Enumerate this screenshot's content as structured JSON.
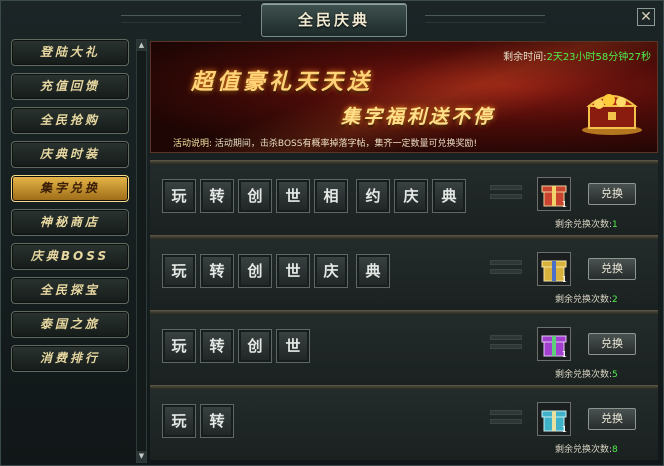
{
  "window": {
    "title": "全民庆典",
    "close_label": "✕"
  },
  "sidebar": {
    "items": [
      {
        "label": "登陆大礼",
        "active": false
      },
      {
        "label": "充值回馈",
        "active": false
      },
      {
        "label": "全民抢购",
        "active": false
      },
      {
        "label": "庆典时装",
        "active": false
      },
      {
        "label": "集字兑换",
        "active": true
      },
      {
        "label": "神秘商店",
        "active": false
      },
      {
        "label": "庆典BOSS",
        "active": false
      },
      {
        "label": "全民探宝",
        "active": false
      },
      {
        "label": "泰国之旅",
        "active": false
      },
      {
        "label": "消费排行",
        "active": false
      }
    ]
  },
  "banner": {
    "timer_label": "剩余时间:",
    "timer_value": "2天23小时58分钟27秒",
    "slogan1": "超值豪礼天天送",
    "slogan2": "集字福利送不停",
    "desc_label": "活动说明:",
    "desc_text": "活动期间，击杀BOSS有概率掉落字帖，集齐一定数量可兑换奖励!"
  },
  "rows": [
    {
      "tiles": [
        "玩",
        "转",
        "创",
        "世",
        "相",
        "约",
        "庆",
        "典"
      ],
      "gift_color": "#c9432f",
      "gift_count": "1",
      "button": "兑换",
      "remain_label": "剩余兑换次数:",
      "remain": "1"
    },
    {
      "tiles": [
        "玩",
        "转",
        "创",
        "世",
        "庆",
        "典"
      ],
      "gift_color": "#d8b23c",
      "gift_count": "1",
      "button": "兑换",
      "remain_label": "剩余兑换次数:",
      "remain": "2"
    },
    {
      "tiles": [
        "玩",
        "转",
        "创",
        "世"
      ],
      "gift_color": "#a33fcf",
      "gift_count": "1",
      "button": "兑换",
      "remain_label": "剩余兑换次数:",
      "remain": "5"
    },
    {
      "tiles": [
        "玩",
        "转"
      ],
      "gift_color": "#3fb2c9",
      "gift_count": "1",
      "button": "兑换",
      "remain_label": "剩余兑换次数:",
      "remain": "8"
    }
  ],
  "colors": {
    "accent_gold": "#e8b84a",
    "remain_green": "#4ef04a"
  }
}
